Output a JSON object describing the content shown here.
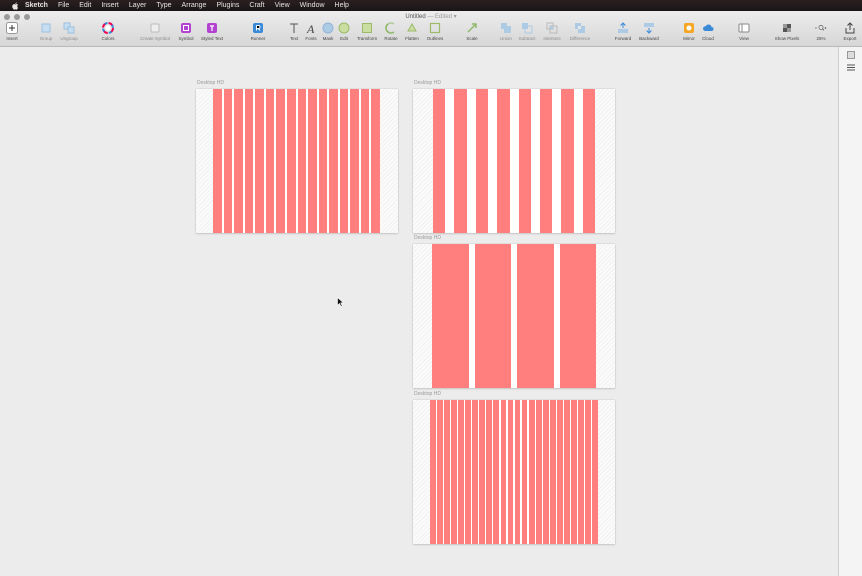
{
  "menubar": {
    "app_name": "Sketch",
    "items": [
      "File",
      "Edit",
      "Insert",
      "Layer",
      "Type",
      "Arrange",
      "Plugins",
      "Craft",
      "View",
      "Window",
      "Help"
    ]
  },
  "window": {
    "title": "Untitled",
    "status": "— Edited ▾"
  },
  "toolbar": {
    "insert": "Insert",
    "group": "Group",
    "ungroup": "Ungroup",
    "colors": "Colors",
    "create_symbol": "Create Symbol",
    "symbol": "Symbol",
    "styled_text": "Styled Text",
    "runner": "Runner",
    "text": "Text",
    "fonts": "Fonts",
    "mask": "Mask",
    "edit": "Edit",
    "transform": "Transform",
    "rotate": "Rotate",
    "flatten": "Flatten",
    "outlines": "Outlines",
    "scale": "Scale",
    "union": "Union",
    "subtract": "Subtract",
    "intersect": "Intersect",
    "difference": "Difference",
    "forward": "Forward",
    "backward": "Backward",
    "mirror": "Mirror",
    "cloud": "Cloud",
    "view": "View",
    "show_pixels": "Show Pixels",
    "zoom": "25%",
    "export": "Export"
  },
  "artboards": [
    {
      "label": "Desktop HD",
      "columns": 16
    },
    {
      "label": "Desktop HD",
      "columns": 8
    },
    {
      "label": "Desktop HD",
      "columns": 4
    },
    {
      "label": "Desktop HD",
      "columns": 24
    }
  ],
  "colors": {
    "column_fill": "#ff7f7f",
    "accent_blue": "#3b8ad8",
    "symbol_purple": "#b243d1"
  }
}
